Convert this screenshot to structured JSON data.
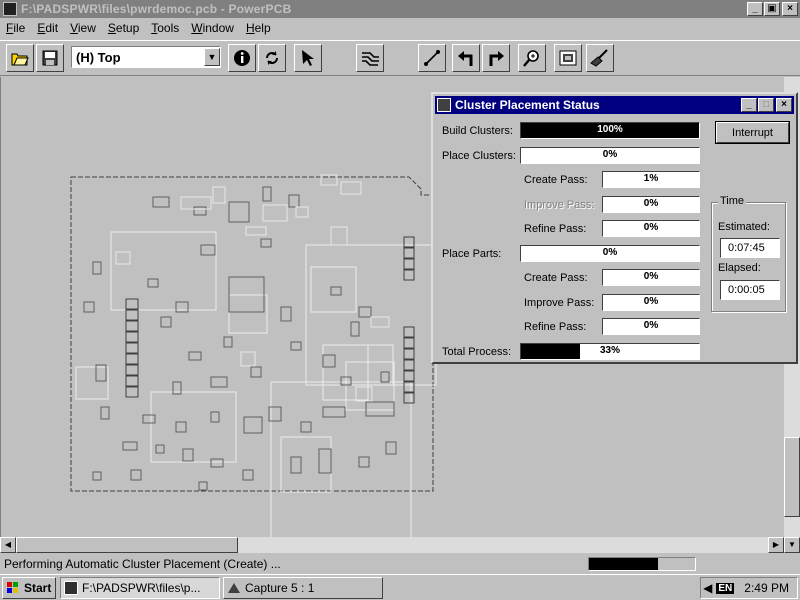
{
  "window": {
    "title": "F:\\PADSPWR\\files\\pwrdemoc.pcb - PowerPCB",
    "min": "_",
    "max": "▣",
    "close": "×"
  },
  "menu": [
    "File",
    "Edit",
    "View",
    "Setup",
    "Tools",
    "Window",
    "Help"
  ],
  "menu_hotkeys": [
    "F",
    "E",
    "V",
    "S",
    "T",
    "W",
    "H"
  ],
  "toolbar": {
    "layer": "(H) Top",
    "icons": [
      "open-icon",
      "save-icon",
      "info-icon",
      "redraw-icon",
      "select-arrow-icon",
      "design-toolbar-icon",
      "route-icon",
      "ecO-left-icon",
      "ecO-right-icon",
      "zoom-icon",
      "cam-icon",
      "broom-icon"
    ]
  },
  "dialog": {
    "title": "Cluster Placement Status",
    "interrupt_label": "Interrupt",
    "rows": [
      {
        "label": "Build Clusters:",
        "value": "100%",
        "fraction": 1.0,
        "indent": false,
        "dim": false
      },
      {
        "label": "Place Clusters:",
        "value": "0%",
        "fraction": 0.0,
        "indent": false,
        "dim": false
      },
      {
        "label": "Create Pass:",
        "value": "1%",
        "fraction": 0.0,
        "indent": true,
        "dim": false
      },
      {
        "label": "Improve Pass:",
        "value": "0%",
        "fraction": 0.0,
        "indent": true,
        "dim": true
      },
      {
        "label": "Refine Pass:",
        "value": "0%",
        "fraction": 0.0,
        "indent": true,
        "dim": false
      },
      {
        "label": "Place Parts:",
        "value": "0%",
        "fraction": 0.0,
        "indent": false,
        "dim": false
      },
      {
        "label": "Create Pass:",
        "value": "0%",
        "fraction": 0.0,
        "indent": true,
        "dim": false
      },
      {
        "label": "Improve Pass:",
        "value": "0%",
        "fraction": 0.0,
        "indent": true,
        "dim": false
      },
      {
        "label": "Refine Pass:",
        "value": "0%",
        "fraction": 0.0,
        "indent": true,
        "dim": false
      },
      {
        "label": "Total Process:",
        "value": "33%",
        "fraction": 0.33,
        "indent": false,
        "dim": false
      }
    ],
    "time": {
      "legend": "Time",
      "estimated_label": "Estimated:",
      "estimated_value": "0:07:45",
      "elapsed_label": "Elapsed:",
      "elapsed_value": "0:00:05"
    }
  },
  "status": {
    "message": "Performing Automatic Cluster Placement (Create) ...",
    "progress_fraction": 0.65
  },
  "taskbar": {
    "start": "Start",
    "tasks": [
      "F:\\PADSPWR\\files\\p...",
      "Capture 5 : 1"
    ],
    "lang": "EN",
    "clock": "2:49 PM"
  },
  "colors": {
    "face": "#c0c0c0",
    "dialog_title": "#000080",
    "inactive_title": "#808080",
    "board_outline": "#404040",
    "component_outline": "#606060",
    "cluster_outline": "#e8e8e8"
  }
}
